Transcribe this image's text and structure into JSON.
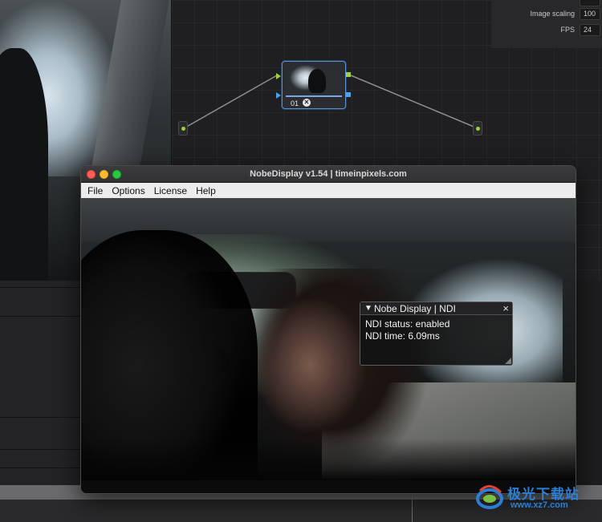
{
  "inspector": {
    "image_scaling_label": "Image scaling",
    "image_scaling_value": "100",
    "fps_label": "FPS",
    "fps_value": "24"
  },
  "node_editor": {
    "clip_node_label": "01",
    "clip_node_fx_icon": "fx-badge-icon"
  },
  "window": {
    "title": "NobeDisplay v1.54 | timeinpixels.com",
    "menu": [
      "File",
      "Options",
      "License",
      "Help"
    ]
  },
  "ndi_panel": {
    "title": "Nobe Display | NDI",
    "close_glyph": "×",
    "collapse_glyph": "▼",
    "status": "NDI status: enabled",
    "time": "NDI time: 6.09ms"
  },
  "watermark": {
    "cn": "极光下载站",
    "url": "www.xz7.com"
  },
  "colors": {
    "accent": "#4ba3e8",
    "node_port_green": "#9fd040",
    "playhead": "#e0413a",
    "watermark": "#2a7fd4"
  }
}
